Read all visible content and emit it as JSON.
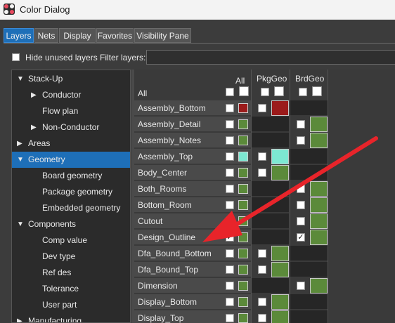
{
  "window": {
    "title": "Color Dialog"
  },
  "tabs": [
    {
      "label": "Layers",
      "active": true
    },
    {
      "label": "Nets"
    },
    {
      "label": "Display"
    },
    {
      "label": "Favorites"
    },
    {
      "label": "Visibility Pane"
    }
  ],
  "toolbar": {
    "hide_unused_label": "Hide unused layers",
    "hide_unused_checked": false,
    "filter_label": "Filter layers:",
    "filter_value": ""
  },
  "tree": [
    {
      "label": "Stack-Up",
      "expander": "down",
      "level": 0
    },
    {
      "label": "Conductor",
      "expander": "right",
      "level": 1
    },
    {
      "label": "Flow plan",
      "expander": "none",
      "level": 1
    },
    {
      "label": "Non-Conductor",
      "expander": "right",
      "level": 1
    },
    {
      "label": "Areas",
      "expander": "right",
      "level": 0
    },
    {
      "label": "Geometry",
      "expander": "down",
      "level": 0,
      "selected": true
    },
    {
      "label": "Board geometry",
      "expander": "none",
      "level": 1
    },
    {
      "label": "Package geometry",
      "expander": "none",
      "level": 1
    },
    {
      "label": "Embedded geometry",
      "expander": "none",
      "level": 1
    },
    {
      "label": "Components",
      "expander": "down",
      "level": 0
    },
    {
      "label": "Comp value",
      "expander": "none",
      "level": 1
    },
    {
      "label": "Dev type",
      "expander": "none",
      "level": 1
    },
    {
      "label": "Ref des",
      "expander": "none",
      "level": 1
    },
    {
      "label": "Tolerance",
      "expander": "none",
      "level": 1
    },
    {
      "label": "User part",
      "expander": "none",
      "level": 1
    },
    {
      "label": "Manufacturing",
      "expander": "right",
      "level": 0
    }
  ],
  "grid": {
    "columns": {
      "all": "All",
      "pkg": "PkgGeo",
      "brd": "BrdGeo"
    },
    "all_row_label": "All",
    "rows": [
      {
        "label": "Assembly_Bottom",
        "color": "#9b1b1b",
        "pkg": true,
        "pkg_checked": false,
        "brd": false,
        "brd_checked": false
      },
      {
        "label": "Assembly_Detail",
        "color": "#5b8a3a",
        "pkg": false,
        "pkg_checked": false,
        "brd": true,
        "brd_checked": false
      },
      {
        "label": "Assembly_Notes",
        "color": "#5b8a3a",
        "pkg": false,
        "pkg_checked": false,
        "brd": true,
        "brd_checked": false
      },
      {
        "label": "Assembly_Top",
        "color": "#7de8d2",
        "pkg": true,
        "pkg_checked": false,
        "brd": false,
        "brd_checked": false
      },
      {
        "label": "Body_Center",
        "color": "#5b8a3a",
        "pkg": true,
        "pkg_checked": false,
        "brd": false,
        "brd_checked": false
      },
      {
        "label": "Both_Rooms",
        "color": "#5b8a3a",
        "pkg": false,
        "pkg_checked": false,
        "brd": true,
        "brd_checked": false
      },
      {
        "label": "Bottom_Room",
        "color": "#5b8a3a",
        "pkg": false,
        "pkg_checked": false,
        "brd": true,
        "brd_checked": false
      },
      {
        "label": "Cutout",
        "color": "#5b8a3a",
        "pkg": false,
        "pkg_checked": false,
        "brd": true,
        "brd_checked": false
      },
      {
        "label": "Design_Outline",
        "color": "#5b8a3a",
        "all_checked": true,
        "pkg": false,
        "pkg_checked": false,
        "brd": true,
        "brd_checked": true
      },
      {
        "label": "Dfa_Bound_Bottom",
        "color": "#5b8a3a",
        "pkg": true,
        "pkg_checked": false,
        "brd": false,
        "brd_checked": false
      },
      {
        "label": "Dfa_Bound_Top",
        "color": "#5b8a3a",
        "pkg": true,
        "pkg_checked": false,
        "brd": false,
        "brd_checked": false
      },
      {
        "label": "Dimension",
        "color": "#5b8a3a",
        "pkg": false,
        "pkg_checked": false,
        "brd": true,
        "brd_checked": false
      },
      {
        "label": "Display_Bottom",
        "color": "#5b8a3a",
        "pkg": true,
        "pkg_checked": false,
        "brd": false,
        "brd_checked": false
      },
      {
        "label": "Display_Top",
        "color": "#5b8a3a",
        "pkg": true,
        "pkg_checked": false,
        "brd": false,
        "brd_checked": false
      }
    ]
  },
  "annotation": {
    "arrow_color": "#e8242a"
  }
}
